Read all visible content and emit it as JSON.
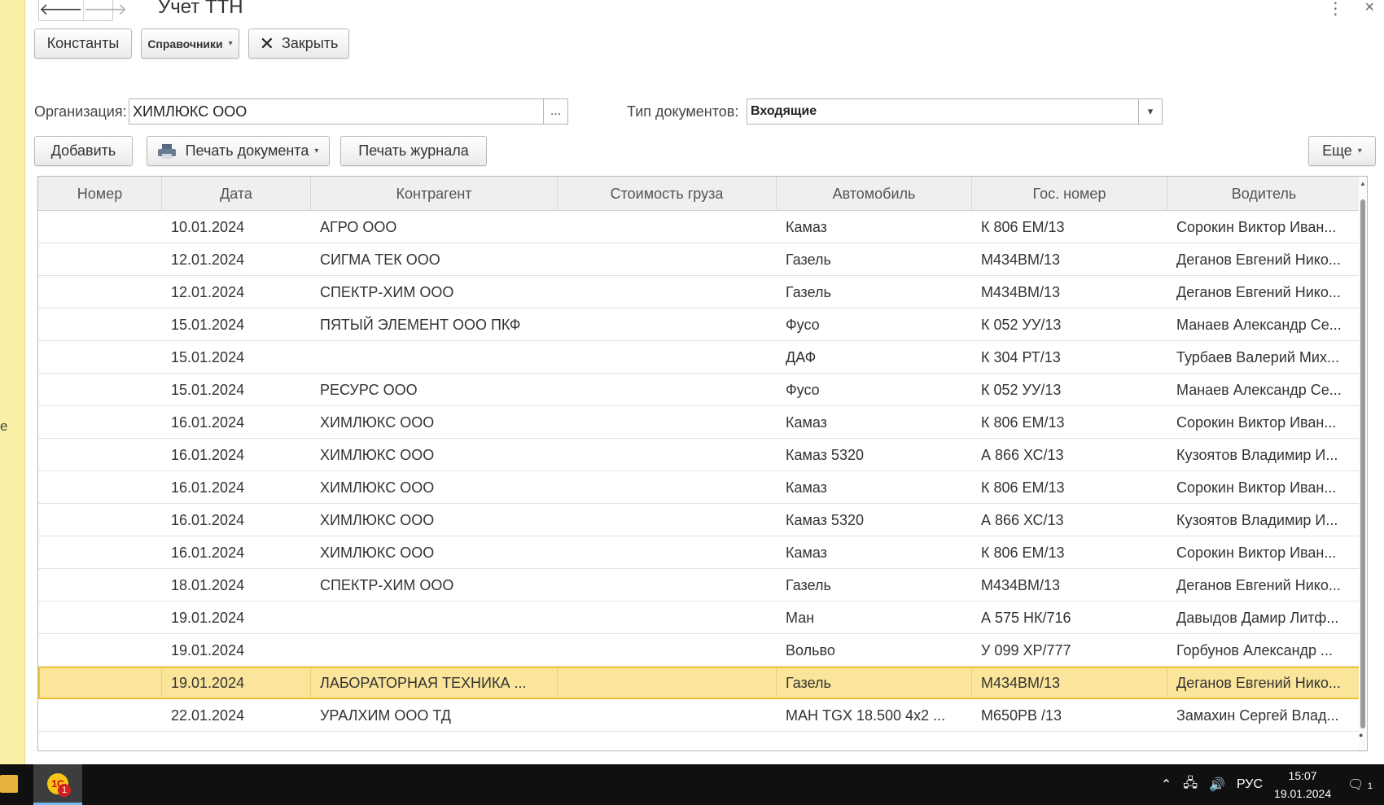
{
  "window": {
    "title": "Учет ТТН",
    "nav_back": "🡐",
    "nav_forward": "🡒",
    "more_icon": "⋮",
    "close_icon": "×"
  },
  "toolbar": {
    "constants_label": "Константы",
    "references_label": "Справочники",
    "close_label": "Закрыть"
  },
  "filters": {
    "organization_label": "Организация:",
    "organization_value": "ХИМЛЮКС ООО",
    "organization_select_btn": "...",
    "doc_type_label": "Тип документов:",
    "doc_type_value": "Входящие",
    "doc_type_dropdown": "▾"
  },
  "list_toolbar": {
    "add_label": "Добавить",
    "print_document_label": "Печать документа",
    "print_journal_label": "Печать журнала",
    "more_label": "Еще"
  },
  "table": {
    "columns": [
      "Номер",
      "Дата",
      "Контрагент",
      "Стоимость груза",
      "Автомобиль",
      "Гос. номер",
      "Водитель"
    ],
    "rows": [
      [
        "",
        "10.01.2024",
        "АГРО ООО",
        "",
        "Камаз",
        "К 806 ЕМ/13",
        "Сорокин Виктор Иван..."
      ],
      [
        "",
        "12.01.2024",
        "СИГМА ТЕК ООО",
        "",
        "Газель",
        "М434ВМ/13",
        "Деганов Евгений Нико..."
      ],
      [
        "",
        "12.01.2024",
        "СПЕКТР-ХИМ ООО",
        "",
        "Газель",
        "М434ВМ/13",
        "Деганов Евгений Нико..."
      ],
      [
        "",
        "15.01.2024",
        "ПЯТЫЙ ЭЛЕМЕНТ ООО ПКФ",
        "",
        "Фусо",
        "К 052 УУ/13",
        "Манаев Александр Се..."
      ],
      [
        "",
        "15.01.2024",
        "",
        "",
        "ДАФ",
        "К 304 РТ/13",
        "Турбаев Валерий Мих..."
      ],
      [
        "",
        "15.01.2024",
        "РЕСУРС ООО",
        "",
        "Фусо",
        "К 052 УУ/13",
        "Манаев Александр Се..."
      ],
      [
        "",
        "16.01.2024",
        "ХИМЛЮКС ООО",
        "",
        "Камаз",
        "К 806 ЕМ/13",
        "Сорокин Виктор Иван..."
      ],
      [
        "",
        "16.01.2024",
        "ХИМЛЮКС ООО",
        "",
        "Камаз 5320",
        "А 866 ХС/13",
        "Кузоятов Владимир И..."
      ],
      [
        "",
        "16.01.2024",
        "ХИМЛЮКС ООО",
        "",
        "Камаз",
        "К 806 ЕМ/13",
        "Сорокин Виктор Иван..."
      ],
      [
        "",
        "16.01.2024",
        "ХИМЛЮКС ООО",
        "",
        "Камаз 5320",
        "А 866 ХС/13",
        "Кузоятов Владимир И..."
      ],
      [
        "",
        "16.01.2024",
        "ХИМЛЮКС ООО",
        "",
        "Камаз",
        "К 806 ЕМ/13",
        "Сорокин Виктор Иван..."
      ],
      [
        "",
        "18.01.2024",
        "СПЕКТР-ХИМ ООО",
        "",
        "Газель",
        "М434ВМ/13",
        "Деганов Евгений Нико..."
      ],
      [
        "",
        "19.01.2024",
        "",
        "",
        "Ман",
        "А 575 НК/716",
        "Давыдов Дамир Литф..."
      ],
      [
        "",
        "19.01.2024",
        "",
        "",
        "Вольво",
        "У 099 ХР/777",
        "Горбунов Александр ..."
      ],
      [
        "",
        "19.01.2024",
        "ЛАБОРАТОРНАЯ ТЕХНИКА ...",
        "",
        "Газель",
        "М434ВМ/13",
        "Деганов Евгений Нико..."
      ],
      [
        "",
        "22.01.2024",
        "УРАЛХИМ ООО ТД",
        "",
        "МАН TGX 18.500 4x2 ...",
        "М650РВ /13",
        "Замахин Сергей Влад..."
      ]
    ],
    "selected_row": 14
  },
  "taskbar": {
    "app_icon_text": "1С",
    "app_badge": "1",
    "chevron": "⌃",
    "network_icon": "🖧",
    "volume_icon": "🔊",
    "lang": "РУС",
    "time": "15:07",
    "date": "19.01.2024",
    "notification_icon": "🗨",
    "notification_count": "1"
  },
  "side_fragment": "е"
}
